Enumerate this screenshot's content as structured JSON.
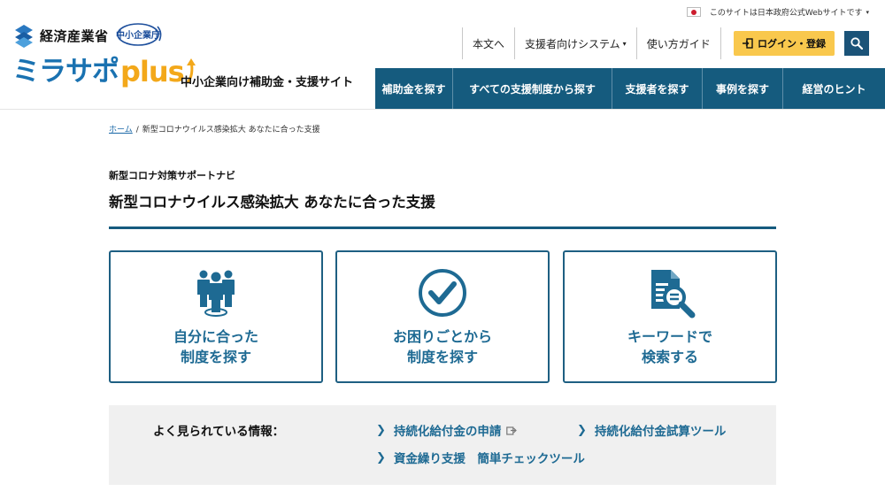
{
  "gov_bar": {
    "text": "このサイトは日本政府公式Webサイトです",
    "caret": "▾"
  },
  "logos": {
    "meti": "経済産業省",
    "chusho": "中小企業庁",
    "mirasapo": "ミラサポ",
    "plus": "plus",
    "subtitle": "中小企業向け補助金・支援サイト"
  },
  "util_nav": [
    {
      "label": "本文へ"
    },
    {
      "label": "支援者向けシステム",
      "caret": "▾"
    },
    {
      "label": "使い方ガイド"
    }
  ],
  "login": {
    "label": "ログイン・登録"
  },
  "main_nav": [
    {
      "label": "補助金を探す",
      "width": 88
    },
    {
      "label": "すべての支援制度から探す",
      "width": 180
    },
    {
      "label": "支援者を探す",
      "width": 102
    },
    {
      "label": "事例を探す",
      "width": 91
    },
    {
      "label": "経営のヒント",
      "width": 115
    }
  ],
  "breadcrumb": {
    "home": "ホーム",
    "sep": "/",
    "current": "新型コロナウイルス感染拡大 あなたに合った支援"
  },
  "eyebrow": "新型コロナ対策サポートナビ",
  "page_title": "新型コロナウイルス感染拡大 あなたに合った支援",
  "cards": [
    {
      "icon": "people-icon",
      "line1": "自分に合った",
      "line2": "制度を探す"
    },
    {
      "icon": "checkmark-circle-icon",
      "line1": "お困りごとから",
      "line2": "制度を探す"
    },
    {
      "icon": "document-search-icon",
      "line1": "キーワードで",
      "line2": "検索する"
    }
  ],
  "popular": {
    "label": "よく見られている情報：",
    "links": [
      {
        "text": "持続化給付金の申請",
        "external": true
      },
      {
        "text": "持続化給付金試算ツール",
        "external": false
      },
      {
        "text": "資金繰り支援　簡単チェックツール",
        "external": false
      }
    ]
  },
  "colors": {
    "navy": "#155b7e",
    "accent_blue": "#1e6a93",
    "login_yellow": "#f9c84d",
    "plus_orange": "#f3a81a"
  }
}
